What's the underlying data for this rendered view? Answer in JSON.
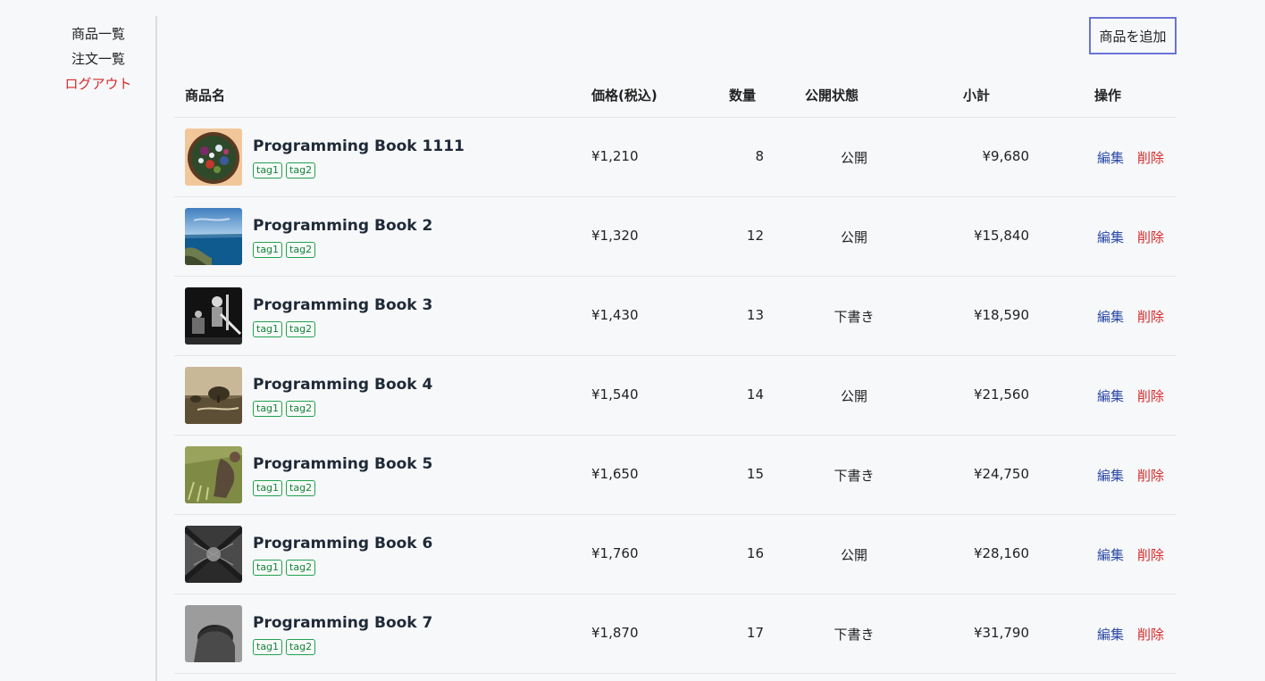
{
  "sidebar": {
    "items": [
      {
        "label": "商品一覧"
      },
      {
        "label": "注文一覧"
      },
      {
        "label": "ログアウト",
        "color": "#d42a2a"
      }
    ]
  },
  "toolbar": {
    "add_label": "商品を追加"
  },
  "table": {
    "headers": {
      "name": "商品名",
      "price": "価格(税込)",
      "qty": "数量",
      "status": "公開状態",
      "subtotal": "小計",
      "actions": "操作"
    },
    "rows": [
      {
        "thumb": "salad",
        "name": "Programming Book 1111",
        "tags": [
          "tag1",
          "tag2"
        ],
        "price": "¥1,210",
        "qty": "8",
        "status": "公開",
        "subtotal": "¥9,680",
        "edit": "編集",
        "delete": "削除"
      },
      {
        "thumb": "sea",
        "name": "Programming Book 2",
        "tags": [
          "tag1",
          "tag2"
        ],
        "price": "¥1,320",
        "qty": "12",
        "status": "公開",
        "subtotal": "¥15,840",
        "edit": "編集",
        "delete": "削除"
      },
      {
        "thumb": "concert",
        "name": "Programming Book 3",
        "tags": [
          "tag1",
          "tag2"
        ],
        "price": "¥1,430",
        "qty": "13",
        "status": "下書き",
        "subtotal": "¥18,590",
        "edit": "編集",
        "delete": "削除"
      },
      {
        "thumb": "landscape",
        "name": "Programming Book 4",
        "tags": [
          "tag1",
          "tag2"
        ],
        "price": "¥1,540",
        "qty": "14",
        "status": "公開",
        "subtotal": "¥21,560",
        "edit": "編集",
        "delete": "削除"
      },
      {
        "thumb": "grass",
        "name": "Programming Book 5",
        "tags": [
          "tag1",
          "tag2"
        ],
        "price": "¥1,650",
        "qty": "15",
        "status": "下書き",
        "subtotal": "¥24,750",
        "edit": "編集",
        "delete": "削除"
      },
      {
        "thumb": "architecture",
        "name": "Programming Book 6",
        "tags": [
          "tag1",
          "tag2"
        ],
        "price": "¥1,760",
        "qty": "16",
        "status": "公開",
        "subtotal": "¥28,160",
        "edit": "編集",
        "delete": "削除"
      },
      {
        "thumb": "portrait",
        "name": "Programming Book 7",
        "tags": [
          "tag1",
          "tag2"
        ],
        "price": "¥1,870",
        "qty": "17",
        "status": "下書き",
        "subtotal": "¥31,790",
        "edit": "編集",
        "delete": "削除"
      }
    ]
  },
  "colors": {
    "background": "#f7f8fa",
    "accent_border": "#6b73d6",
    "link_edit": "#2c4aa6",
    "link_delete": "#d42a2a",
    "tag_green": "#15803d"
  }
}
